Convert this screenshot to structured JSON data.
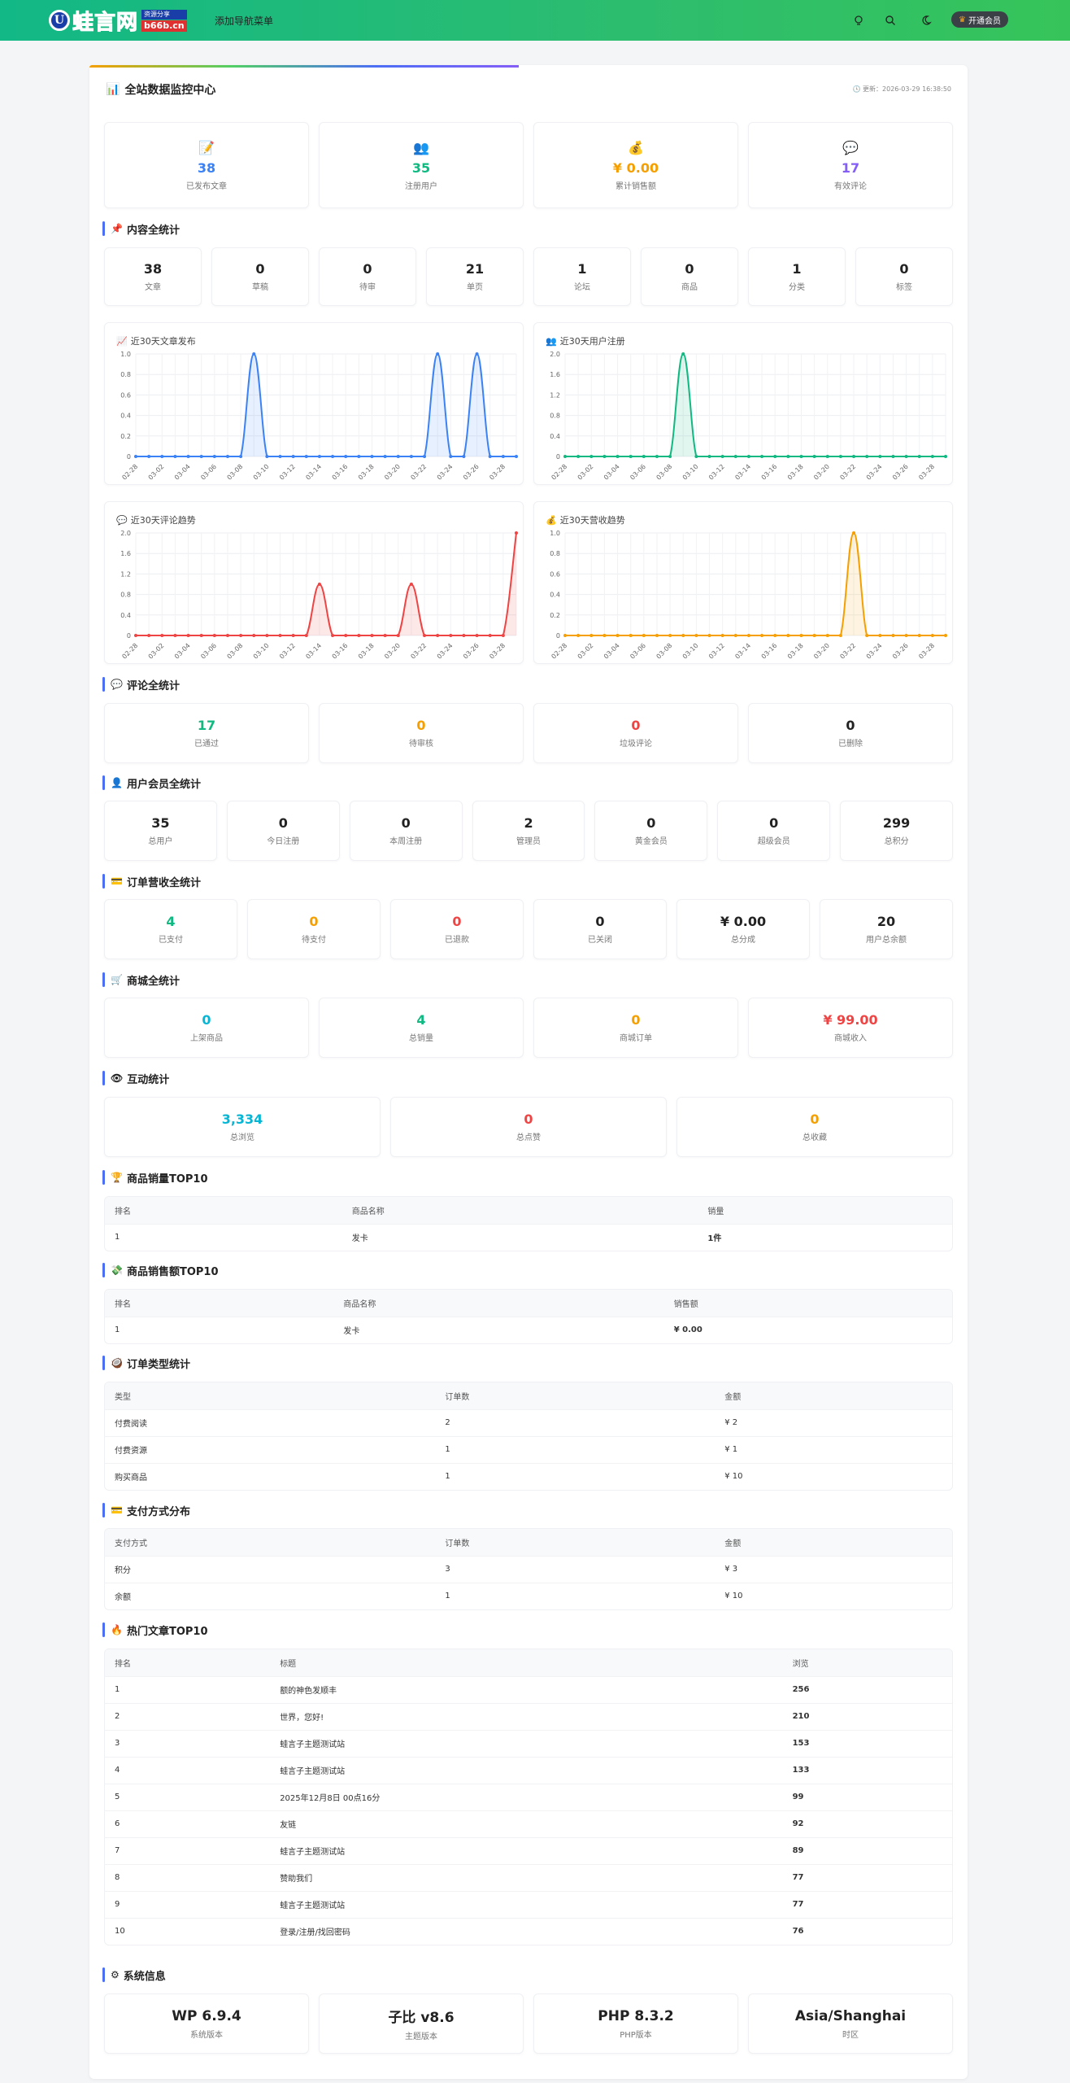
{
  "header": {
    "logo_mark": "U",
    "logo_text": "蛙言网",
    "logo_tag": "资源分享",
    "logo_domain": "b66b.cn",
    "nav_link": "添加导航菜单",
    "vip_label": "开通会员"
  },
  "panel": {
    "title": "全站数据监控中心",
    "updated": "更新：2026-03-29 16:38:50"
  },
  "summary": [
    {
      "icon": "📝",
      "value": "38",
      "label": "已发布文章",
      "color": "#3b82f6"
    },
    {
      "icon": "👥",
      "value": "35",
      "label": "注册用户",
      "color": "#10b981"
    },
    {
      "icon": "💰",
      "value": "¥ 0.00",
      "label": "累计销售额",
      "color": "#f59f00"
    },
    {
      "icon": "💬",
      "value": "17",
      "label": "有效评论",
      "color": "#845ef7"
    }
  ],
  "content": {
    "title": "内容全统计",
    "icon": "📌",
    "items": [
      {
        "value": "38",
        "label": "文章"
      },
      {
        "value": "0",
        "label": "草稿"
      },
      {
        "value": "0",
        "label": "待审"
      },
      {
        "value": "21",
        "label": "单页"
      },
      {
        "value": "1",
        "label": "论坛"
      },
      {
        "value": "0",
        "label": "商品"
      },
      {
        "value": "1",
        "label": "分类"
      },
      {
        "value": "0",
        "label": "标签"
      }
    ]
  },
  "chart_data": [
    {
      "type": "area",
      "title": "近30天文章发布",
      "icon": "📈",
      "color": "#3b82f6",
      "ylim": [
        0,
        1
      ],
      "yticks": [
        "0",
        "0.2",
        "0.4",
        "0.6",
        "0.8",
        "1.0"
      ],
      "xtick_labels": [
        "02-28",
        "03-02",
        "03-04",
        "03-06",
        "03-08",
        "03-10",
        "03-12",
        "03-14",
        "03-16",
        "03-18",
        "03-20",
        "03-22",
        "03-24",
        "03-26",
        "03-28"
      ],
      "values": [
        0,
        0,
        0,
        0,
        0,
        0,
        0,
        0,
        0,
        1,
        0,
        0,
        0,
        0,
        0,
        0,
        0,
        0,
        0,
        0,
        0,
        0,
        0,
        1,
        0,
        0,
        1,
        0,
        0,
        0
      ]
    },
    {
      "type": "area",
      "title": "近30天用户注册",
      "icon": "👥",
      "color": "#10b981",
      "ylim": [
        0,
        2
      ],
      "yticks": [
        "0",
        "0.4",
        "0.8",
        "1.2",
        "1.6",
        "2.0"
      ],
      "xtick_labels": [
        "02-28",
        "03-02",
        "03-04",
        "03-06",
        "03-08",
        "03-10",
        "03-12",
        "03-14",
        "03-16",
        "03-18",
        "03-20",
        "03-22",
        "03-24",
        "03-26",
        "03-28"
      ],
      "values": [
        0,
        0,
        0,
        0,
        0,
        0,
        0,
        0,
        0,
        2,
        0,
        0,
        0,
        0,
        0,
        0,
        0,
        0,
        0,
        0,
        0,
        0,
        0,
        0,
        0,
        0,
        0,
        0,
        0,
        0
      ]
    },
    {
      "type": "area",
      "title": "近30天评论趋势",
      "icon": "💬",
      "color": "#ef4444",
      "ylim": [
        0,
        2
      ],
      "yticks": [
        "0",
        "0.4",
        "0.8",
        "1.2",
        "1.6",
        "2.0"
      ],
      "xtick_labels": [
        "02-28",
        "03-02",
        "03-04",
        "03-06",
        "03-08",
        "03-10",
        "03-12",
        "03-14",
        "03-16",
        "03-18",
        "03-20",
        "03-22",
        "03-24",
        "03-26",
        "03-28"
      ],
      "values": [
        0,
        0,
        0,
        0,
        0,
        0,
        0,
        0,
        0,
        0,
        0,
        0,
        0,
        0,
        1,
        0,
        0,
        0,
        0,
        0,
        0,
        1,
        0,
        0,
        0,
        0,
        0,
        0,
        0,
        2
      ]
    },
    {
      "type": "area",
      "title": "近30天营收趋势",
      "icon": "💰",
      "color": "#f59f00",
      "ylim": [
        0,
        1
      ],
      "yticks": [
        "0",
        "0.2",
        "0.4",
        "0.6",
        "0.8",
        "1.0"
      ],
      "xtick_labels": [
        "02-28",
        "03-02",
        "03-04",
        "03-06",
        "03-08",
        "03-10",
        "03-12",
        "03-14",
        "03-16",
        "03-18",
        "03-20",
        "03-22",
        "03-24",
        "03-26",
        "03-28"
      ],
      "values": [
        0,
        0,
        0,
        0,
        0,
        0,
        0,
        0,
        0,
        0,
        0,
        0,
        0,
        0,
        0,
        0,
        0,
        0,
        0,
        0,
        0,
        0,
        1,
        0,
        0,
        0,
        0,
        0,
        0,
        0
      ]
    }
  ],
  "comments": {
    "title": "评论全统计",
    "icon": "💬",
    "items": [
      {
        "value": "17",
        "label": "已通过",
        "color": "#10b981"
      },
      {
        "value": "0",
        "label": "待审核",
        "color": "#f59f00"
      },
      {
        "value": "0",
        "label": "垃圾评论",
        "color": "#ef4444"
      },
      {
        "value": "0",
        "label": "已删除",
        "color": "#222"
      }
    ]
  },
  "users": {
    "title": "用户会员全统计",
    "icon": "👤",
    "items": [
      {
        "value": "35",
        "label": "总用户"
      },
      {
        "value": "0",
        "label": "今日注册"
      },
      {
        "value": "0",
        "label": "本周注册"
      },
      {
        "value": "2",
        "label": "管理员"
      },
      {
        "value": "0",
        "label": "黄金会员"
      },
      {
        "value": "0",
        "label": "超级会员"
      },
      {
        "value": "299",
        "label": "总积分"
      }
    ]
  },
  "orders": {
    "title": "订单营收全统计",
    "icon": "💳",
    "items": [
      {
        "value": "4",
        "label": "已支付",
        "color": "#10b981"
      },
      {
        "value": "0",
        "label": "待支付",
        "color": "#f59f00"
      },
      {
        "value": "0",
        "label": "已退款",
        "color": "#ef4444"
      },
      {
        "value": "0",
        "label": "已关闭",
        "color": "#222"
      },
      {
        "value": "¥ 0.00",
        "label": "总分成",
        "color": "#222"
      },
      {
        "value": "20",
        "label": "用户总余额",
        "color": "#222"
      }
    ]
  },
  "shop": {
    "title": "商城全统计",
    "icon": "🛒",
    "items": [
      {
        "value": "0",
        "label": "上架商品",
        "color": "#06b6d4"
      },
      {
        "value": "4",
        "label": "总销量",
        "color": "#10b981"
      },
      {
        "value": "0",
        "label": "商城订单",
        "color": "#f59f00"
      },
      {
        "value": "¥ 99.00",
        "label": "商城收入",
        "color": "#ef4444"
      }
    ]
  },
  "interaction": {
    "title": "互动统计",
    "icon": "👁",
    "items": [
      {
        "value": "3,334",
        "label": "总浏览",
        "color": "#06b6d4"
      },
      {
        "value": "0",
        "label": "总点赞",
        "color": "#ef4444"
      },
      {
        "value": "0",
        "label": "总收藏",
        "color": "#f59f00"
      }
    ]
  },
  "top_sales": {
    "title": "商品销量TOP10",
    "icon": "🏆",
    "headers": [
      "排名",
      "商品名称",
      "销量"
    ],
    "rows": [
      [
        "1",
        "发卡",
        "1件"
      ]
    ]
  },
  "top_revenue": {
    "title": "商品销售额TOP10",
    "icon": "💸",
    "headers": [
      "排名",
      "商品名称",
      "销售额"
    ],
    "rows": [
      [
        "1",
        "发卡",
        "¥ 0.00"
      ]
    ]
  },
  "order_types": {
    "title": "订单类型统计",
    "icon": "🥥",
    "headers": [
      "类型",
      "订单数",
      "金额"
    ],
    "rows": [
      [
        "付费阅读",
        "2",
        "¥ 2"
      ],
      [
        "付费资源",
        "1",
        "¥ 1"
      ],
      [
        "购买商品",
        "1",
        "¥ 10"
      ]
    ]
  },
  "pay_methods": {
    "title": "支付方式分布",
    "icon": "💳",
    "headers": [
      "支付方式",
      "订单数",
      "金额"
    ],
    "rows": [
      [
        "积分",
        "3",
        "¥ 3"
      ],
      [
        "余额",
        "1",
        "¥ 10"
      ]
    ]
  },
  "hot_posts": {
    "title": "热门文章TOP10",
    "icon": "🔥",
    "headers": [
      "排名",
      "标题",
      "浏览"
    ],
    "rows": [
      [
        "1",
        "额的神色发顺丰",
        "256"
      ],
      [
        "2",
        "世界，您好!",
        "210"
      ],
      [
        "3",
        "蛙言子主题测试站",
        "153"
      ],
      [
        "4",
        "蛙言子主题测试站",
        "133"
      ],
      [
        "5",
        "2025年12月8日 00点16分",
        "99"
      ],
      [
        "6",
        "友链",
        "92"
      ],
      [
        "7",
        "蛙言子主题测试站",
        "89"
      ],
      [
        "8",
        "赞助我们",
        "77"
      ],
      [
        "9",
        "蛙言子主题测试站",
        "77"
      ],
      [
        "10",
        "登录/注册/找回密码",
        "76"
      ]
    ]
  },
  "system": {
    "title": "系统信息",
    "icon": "⚙",
    "items": [
      {
        "value": "WP 6.9.4",
        "label": "系统版本"
      },
      {
        "value": "子比 v8.6",
        "label": "主题版本"
      },
      {
        "value": "PHP 8.3.2",
        "label": "PHP版本"
      },
      {
        "value": "Asia/Shanghai",
        "label": "时区"
      }
    ]
  }
}
